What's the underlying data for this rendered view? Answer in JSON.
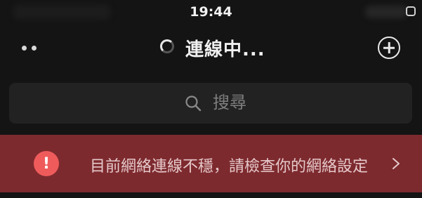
{
  "status_bar": {
    "time": "19:44"
  },
  "nav": {
    "title": "連線中...",
    "more_icon": "more-dots-icon",
    "add_icon": "add-circle-icon"
  },
  "search": {
    "placeholder": "搜尋",
    "icon": "search-icon"
  },
  "alert": {
    "icon_glyph": "!",
    "message": "目前網絡連線不穩，請檢查你的網絡設定",
    "color": "#7d2a2e",
    "icon_color": "#ef5b5b"
  }
}
